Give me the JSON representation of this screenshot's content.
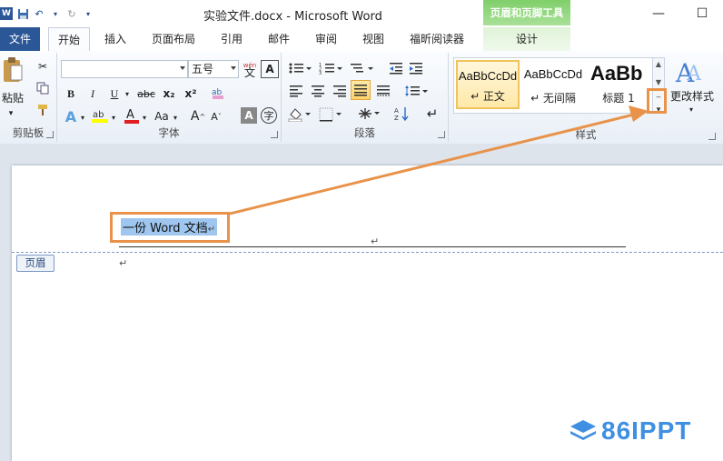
{
  "titlebar": {
    "title": "实验文件.docx - Microsoft Word",
    "context_group": "页眉和页脚工具",
    "minimize": "—",
    "restore": "☐"
  },
  "tabs": [
    {
      "label": "文件"
    },
    {
      "label": "开始"
    },
    {
      "label": "插入"
    },
    {
      "label": "页面布局"
    },
    {
      "label": "引用"
    },
    {
      "label": "邮件"
    },
    {
      "label": "审阅"
    },
    {
      "label": "视图"
    },
    {
      "label": "福昕阅读器"
    },
    {
      "label": "设计"
    }
  ],
  "ribbon": {
    "clipboard": {
      "label": "剪贴板",
      "paste": "粘贴"
    },
    "font": {
      "label": "字体",
      "font_name": "",
      "font_size": "五号",
      "bold": "B",
      "italic": "I",
      "underline": "U",
      "strike": "abc",
      "sub": "x₂",
      "sup": "x²",
      "grow": "A",
      "shrink": "A",
      "case": "Aa",
      "clear": "A",
      "char_border": "A",
      "enclose": "字",
      "wen": "wén",
      "wen_char": "文"
    },
    "paragraph": {
      "label": "段落"
    },
    "styles": {
      "label": "样式",
      "items": [
        {
          "sample": "AaBbCcDd",
          "name": "↵ 正文"
        },
        {
          "sample": "AaBbCcDd",
          "name": "↵ 无间隔"
        },
        {
          "sample": "AaBb",
          "name": "标题 1"
        }
      ],
      "change_styles": "更改样式"
    }
  },
  "document": {
    "header_text": "一份 Word 文档",
    "pilcrow": "↵",
    "header_tag": "页眉"
  },
  "watermark": {
    "text": "86IPPT"
  },
  "colors": {
    "accent": "#2b5797",
    "annotation": "#e8924a",
    "context": "#7fcf6a"
  }
}
